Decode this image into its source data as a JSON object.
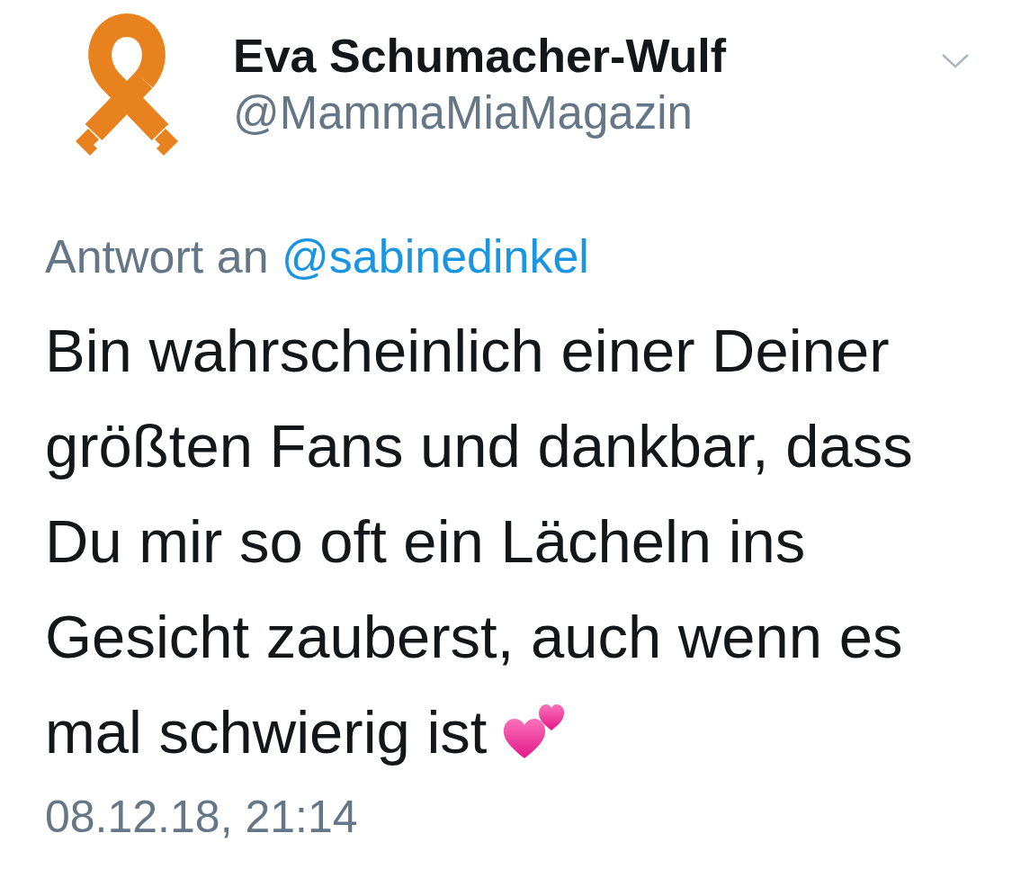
{
  "account": {
    "display_name": "Eva Schumacher-Wulf",
    "handle": "@MammaMiaMagazin"
  },
  "tweet": {
    "reply_prefix": "Antwort an",
    "reply_to": "@sabinedinkel",
    "text": "Bin wahrscheinlich einer Deiner größten Fans und dankbar, dass Du mir so oft ein Lächeln ins Gesicht zauberst, auch wenn es mal schwierig ist",
    "timestamp": "08.12.18, 21:14"
  }
}
